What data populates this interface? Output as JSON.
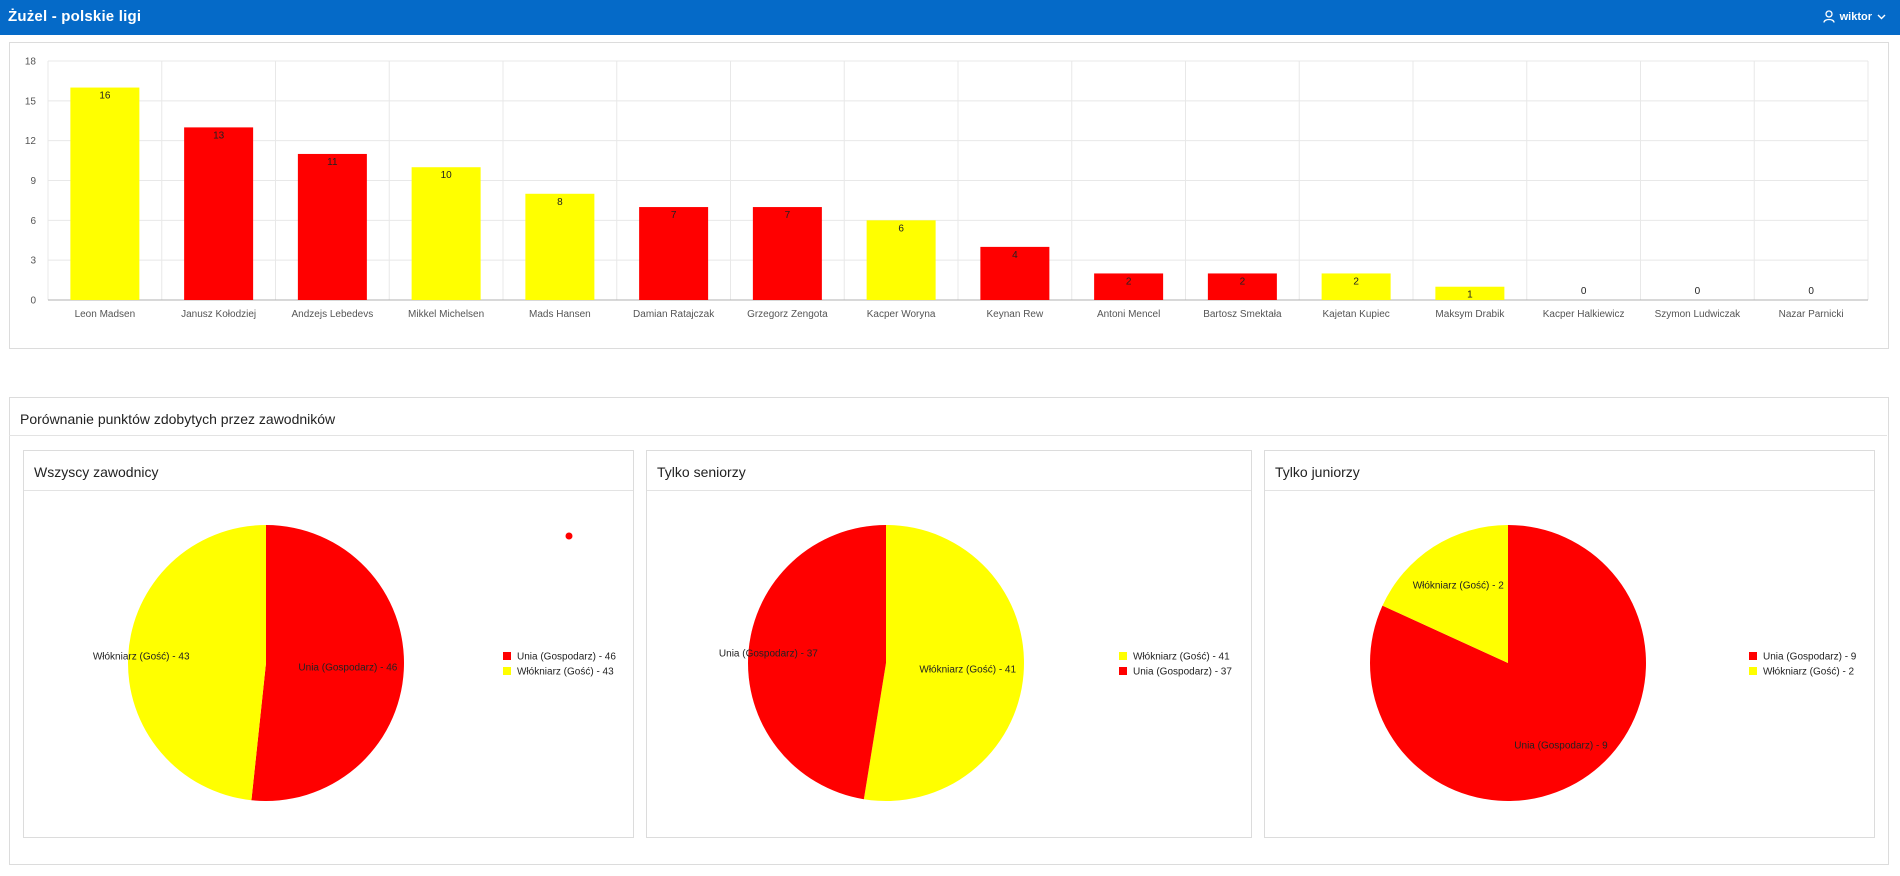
{
  "header": {
    "title": "Żużel - polskie ligi",
    "user": "wiktor",
    "bg_color": "#056AC8"
  },
  "icons": {
    "user": "user-icon",
    "dropdown": "chevron-down-icon"
  },
  "colors": {
    "red": "#FF0000",
    "yellow": "#FFFF00"
  },
  "chart_data": [
    {
      "type": "bar",
      "categories": [
        "Leon Madsen",
        "Janusz Kołodziej",
        "Andzejs Lebedevs",
        "Mikkel Michelsen",
        "Mads Hansen",
        "Damian Ratajczak",
        "Grzegorz Zengota",
        "Kacper Woryna",
        "Keynan Rew",
        "Antoni Mencel",
        "Bartosz Smektała",
        "Kajetan Kupiec",
        "Maksym Drabik",
        "Kacper Halkiewicz",
        "Szymon Ludwiczak",
        "Nazar Parnicki"
      ],
      "values": [
        16,
        13,
        11,
        10,
        8,
        7,
        7,
        6,
        4,
        2,
        2,
        2,
        1,
        0,
        0,
        0
      ],
      "bar_colors": [
        "#FFFF00",
        "#FF0000",
        "#FF0000",
        "#FFFF00",
        "#FFFF00",
        "#FF0000",
        "#FF0000",
        "#FFFF00",
        "#FF0000",
        "#FF0000",
        "#FF0000",
        "#FFFF00",
        "#FFFF00",
        "#FF0000",
        "#FF0000",
        "#FF0000"
      ],
      "yticks": [
        0,
        3,
        6,
        9,
        12,
        15,
        18
      ],
      "ylim": [
        0,
        18
      ],
      "grid": true,
      "title": "",
      "xlabel": "",
      "ylabel": ""
    },
    {
      "type": "pie",
      "title": "Wszyscy zawodnicy",
      "slices": [
        {
          "label": "Unia (Gospodarz) - 46",
          "value": 46,
          "color": "#FF0000"
        },
        {
          "label": "Włókniarz (Gość) - 43",
          "value": 43,
          "color": "#FFFF00"
        }
      ],
      "legend_placement": "right"
    },
    {
      "type": "pie",
      "title": "Tylko seniorzy",
      "slices": [
        {
          "label": "Włókniarz (Gość) - 41",
          "value": 41,
          "color": "#FFFF00"
        },
        {
          "label": "Unia (Gospodarz) - 37",
          "value": 37,
          "color": "#FF0000"
        }
      ],
      "legend_placement": "right"
    },
    {
      "type": "pie",
      "title": "Tylko juniorzy",
      "slices": [
        {
          "label": "Unia (Gospodarz) - 9",
          "value": 9,
          "color": "#FF0000"
        },
        {
          "label": "Włókniarz (Gość) - 2",
          "value": 2,
          "color": "#FFFF00"
        }
      ],
      "legend_placement": "right"
    }
  ],
  "section": {
    "title": "Porównanie punktów zdobytych przez zawodników"
  }
}
